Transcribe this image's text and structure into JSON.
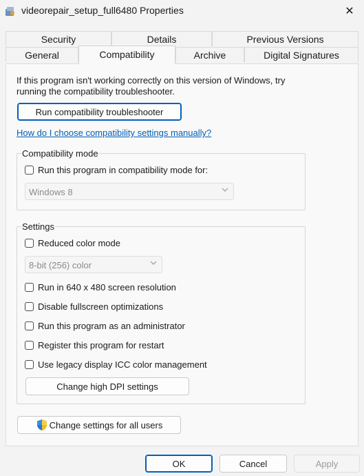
{
  "window": {
    "title": "videorepair_setup_full6480 Properties",
    "close_glyph": "✕"
  },
  "tabs_row1": [
    "Security",
    "Details",
    "Previous Versions"
  ],
  "tabs_row2": [
    "General",
    "Compatibility",
    "Archive",
    "Digital Signatures"
  ],
  "active_tab": "Compatibility",
  "intro": {
    "line1": "If this program isn't working correctly on this version of Windows, try",
    "line2": "running the compatibility troubleshooter."
  },
  "troubleshooter_button": "Run compatibility troubleshooter",
  "help_link": "How do I choose compatibility settings manually?",
  "compat_mode": {
    "legend": "Compatibility mode",
    "checkbox_label": "Run this program in compatibility mode for:",
    "os_select_value": "Windows 8"
  },
  "settings": {
    "legend": "Settings",
    "reduced_color": "Reduced color mode",
    "color_select_value": "8-bit (256) color",
    "res_640": "Run in 640 x 480 screen resolution",
    "fullscreen": "Disable fullscreen optimizations",
    "admin": "Run this program as an administrator",
    "restart": "Register this program for restart",
    "icc": "Use legacy display ICC color management",
    "dpi_button": "Change high DPI settings"
  },
  "all_users_button": "Change settings for all users",
  "footer": {
    "ok": "OK",
    "cancel": "Cancel",
    "apply": "Apply"
  },
  "colors": {
    "accent": "#005fb8",
    "panel_bg": "#f9f9f9",
    "window_bg": "#f3f3f3"
  }
}
